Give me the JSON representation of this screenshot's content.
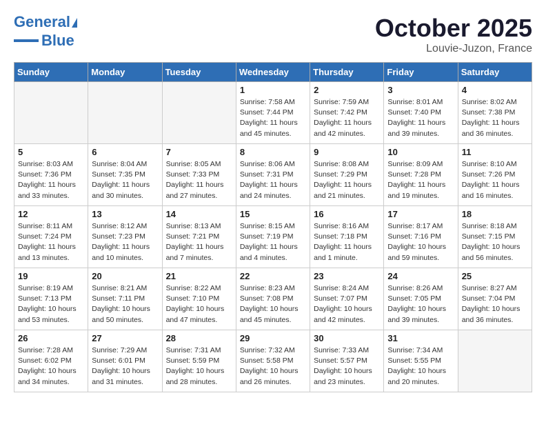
{
  "header": {
    "logo_line1": "General",
    "logo_line2": "Blue",
    "month": "October 2025",
    "location": "Louvie-Juzon, France"
  },
  "weekdays": [
    "Sunday",
    "Monday",
    "Tuesday",
    "Wednesday",
    "Thursday",
    "Friday",
    "Saturday"
  ],
  "weeks": [
    [
      {
        "num": "",
        "info": ""
      },
      {
        "num": "",
        "info": ""
      },
      {
        "num": "",
        "info": ""
      },
      {
        "num": "1",
        "info": "Sunrise: 7:58 AM\nSunset: 7:44 PM\nDaylight: 11 hours and 45 minutes."
      },
      {
        "num": "2",
        "info": "Sunrise: 7:59 AM\nSunset: 7:42 PM\nDaylight: 11 hours and 42 minutes."
      },
      {
        "num": "3",
        "info": "Sunrise: 8:01 AM\nSunset: 7:40 PM\nDaylight: 11 hours and 39 minutes."
      },
      {
        "num": "4",
        "info": "Sunrise: 8:02 AM\nSunset: 7:38 PM\nDaylight: 11 hours and 36 minutes."
      }
    ],
    [
      {
        "num": "5",
        "info": "Sunrise: 8:03 AM\nSunset: 7:36 PM\nDaylight: 11 hours and 33 minutes."
      },
      {
        "num": "6",
        "info": "Sunrise: 8:04 AM\nSunset: 7:35 PM\nDaylight: 11 hours and 30 minutes."
      },
      {
        "num": "7",
        "info": "Sunrise: 8:05 AM\nSunset: 7:33 PM\nDaylight: 11 hours and 27 minutes."
      },
      {
        "num": "8",
        "info": "Sunrise: 8:06 AM\nSunset: 7:31 PM\nDaylight: 11 hours and 24 minutes."
      },
      {
        "num": "9",
        "info": "Sunrise: 8:08 AM\nSunset: 7:29 PM\nDaylight: 11 hours and 21 minutes."
      },
      {
        "num": "10",
        "info": "Sunrise: 8:09 AM\nSunset: 7:28 PM\nDaylight: 11 hours and 19 minutes."
      },
      {
        "num": "11",
        "info": "Sunrise: 8:10 AM\nSunset: 7:26 PM\nDaylight: 11 hours and 16 minutes."
      }
    ],
    [
      {
        "num": "12",
        "info": "Sunrise: 8:11 AM\nSunset: 7:24 PM\nDaylight: 11 hours and 13 minutes."
      },
      {
        "num": "13",
        "info": "Sunrise: 8:12 AM\nSunset: 7:23 PM\nDaylight: 11 hours and 10 minutes."
      },
      {
        "num": "14",
        "info": "Sunrise: 8:13 AM\nSunset: 7:21 PM\nDaylight: 11 hours and 7 minutes."
      },
      {
        "num": "15",
        "info": "Sunrise: 8:15 AM\nSunset: 7:19 PM\nDaylight: 11 hours and 4 minutes."
      },
      {
        "num": "16",
        "info": "Sunrise: 8:16 AM\nSunset: 7:18 PM\nDaylight: 11 hours and 1 minute."
      },
      {
        "num": "17",
        "info": "Sunrise: 8:17 AM\nSunset: 7:16 PM\nDaylight: 10 hours and 59 minutes."
      },
      {
        "num": "18",
        "info": "Sunrise: 8:18 AM\nSunset: 7:15 PM\nDaylight: 10 hours and 56 minutes."
      }
    ],
    [
      {
        "num": "19",
        "info": "Sunrise: 8:19 AM\nSunset: 7:13 PM\nDaylight: 10 hours and 53 minutes."
      },
      {
        "num": "20",
        "info": "Sunrise: 8:21 AM\nSunset: 7:11 PM\nDaylight: 10 hours and 50 minutes."
      },
      {
        "num": "21",
        "info": "Sunrise: 8:22 AM\nSunset: 7:10 PM\nDaylight: 10 hours and 47 minutes."
      },
      {
        "num": "22",
        "info": "Sunrise: 8:23 AM\nSunset: 7:08 PM\nDaylight: 10 hours and 45 minutes."
      },
      {
        "num": "23",
        "info": "Sunrise: 8:24 AM\nSunset: 7:07 PM\nDaylight: 10 hours and 42 minutes."
      },
      {
        "num": "24",
        "info": "Sunrise: 8:26 AM\nSunset: 7:05 PM\nDaylight: 10 hours and 39 minutes."
      },
      {
        "num": "25",
        "info": "Sunrise: 8:27 AM\nSunset: 7:04 PM\nDaylight: 10 hours and 36 minutes."
      }
    ],
    [
      {
        "num": "26",
        "info": "Sunrise: 7:28 AM\nSunset: 6:02 PM\nDaylight: 10 hours and 34 minutes."
      },
      {
        "num": "27",
        "info": "Sunrise: 7:29 AM\nSunset: 6:01 PM\nDaylight: 10 hours and 31 minutes."
      },
      {
        "num": "28",
        "info": "Sunrise: 7:31 AM\nSunset: 5:59 PM\nDaylight: 10 hours and 28 minutes."
      },
      {
        "num": "29",
        "info": "Sunrise: 7:32 AM\nSunset: 5:58 PM\nDaylight: 10 hours and 26 minutes."
      },
      {
        "num": "30",
        "info": "Sunrise: 7:33 AM\nSunset: 5:57 PM\nDaylight: 10 hours and 23 minutes."
      },
      {
        "num": "31",
        "info": "Sunrise: 7:34 AM\nSunset: 5:55 PM\nDaylight: 10 hours and 20 minutes."
      },
      {
        "num": "",
        "info": ""
      }
    ]
  ]
}
